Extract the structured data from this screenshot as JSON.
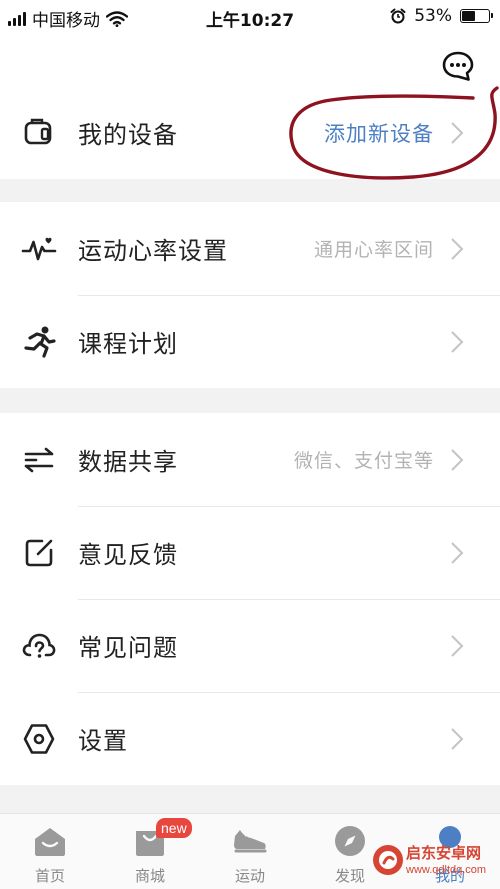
{
  "status_bar": {
    "carrier": "中国移动",
    "time": "上午10:27",
    "battery_percent": "53%",
    "battery_level": 0.53
  },
  "icons": {
    "message": "message-dots-icon",
    "device": "watch-device-icon",
    "heart_rate": "heart-pulse-icon",
    "course": "running-person-icon",
    "share": "sliders-share-icon",
    "feedback": "edit-note-icon",
    "faq": "cloud-question-icon",
    "settings": "hexagon-gear-icon"
  },
  "colors": {
    "accent_blue": "#4c7fc4",
    "annotation_red": "#8e1320",
    "badge_red": "#e8473e",
    "watermark_red": "#d64533"
  },
  "sections": {
    "device": {
      "label": "我的设备",
      "value": "添加新设备"
    },
    "sport": {
      "heart_rate": {
        "label": "运动心率设置",
        "value": "通用心率区间"
      },
      "course": {
        "label": "课程计划",
        "value": ""
      }
    },
    "misc": {
      "share": {
        "label": "数据共享",
        "value": "微信、支付宝等"
      },
      "feedback": {
        "label": "意见反馈"
      },
      "faq": {
        "label": "常见问题"
      },
      "settings": {
        "label": "设置"
      }
    }
  },
  "tabs": [
    {
      "label": "首页"
    },
    {
      "label": "商城",
      "badge": "new"
    },
    {
      "label": "运动"
    },
    {
      "label": "发现"
    },
    {
      "label": "我的"
    }
  ],
  "watermark": {
    "title": "启东安卓网",
    "url": "www.qdltdq.com"
  }
}
